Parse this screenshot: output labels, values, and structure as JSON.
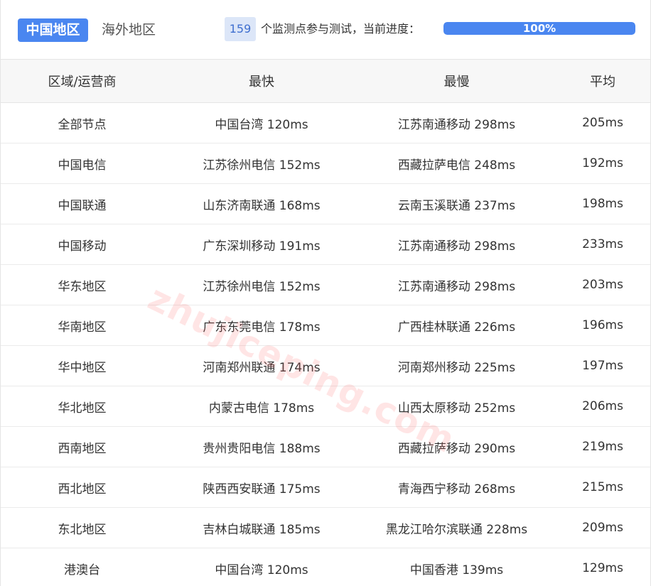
{
  "tabs": {
    "active": "中国地区",
    "inactive": "海外地区"
  },
  "progress": {
    "node_count": "159",
    "description": "个监测点参与测试，当前进度：",
    "percent_label": "100%",
    "percent_value": 100
  },
  "table": {
    "headers": [
      "区域/运营商",
      "最快",
      "最慢",
      "平均"
    ],
    "rows": [
      [
        "全部节点",
        "中国台湾 120ms",
        "江苏南通移动 298ms",
        "205ms"
      ],
      [
        "中国电信",
        "江苏徐州电信 152ms",
        "西藏拉萨电信 248ms",
        "192ms"
      ],
      [
        "中国联通",
        "山东济南联通 168ms",
        "云南玉溪联通 237ms",
        "198ms"
      ],
      [
        "中国移动",
        "广东深圳移动 191ms",
        "江苏南通移动 298ms",
        "233ms"
      ],
      [
        "华东地区",
        "江苏徐州电信 152ms",
        "江苏南通移动 298ms",
        "203ms"
      ],
      [
        "华南地区",
        "广东东莞电信 178ms",
        "广西桂林联通 226ms",
        "196ms"
      ],
      [
        "华中地区",
        "河南郑州联通 174ms",
        "河南郑州移动 225ms",
        "197ms"
      ],
      [
        "华北地区",
        "内蒙古电信 178ms",
        "山西太原移动 252ms",
        "206ms"
      ],
      [
        "西南地区",
        "贵州贵阳电信 188ms",
        "西藏拉萨移动 290ms",
        "219ms"
      ],
      [
        "西北地区",
        "陕西西安联通 175ms",
        "青海西宁移动 268ms",
        "215ms"
      ],
      [
        "东北地区",
        "吉林白城联通 185ms",
        "黑龙江哈尔滨联通 228ms",
        "209ms"
      ],
      [
        "港澳台",
        "中国台湾 120ms",
        "中国香港 139ms",
        "129ms"
      ]
    ]
  },
  "watermark": "zhujiceping.com",
  "colors": {
    "accent": "#4a86f0",
    "badge_bg": "#dce6f8",
    "header_bg": "#f7f7f7"
  }
}
